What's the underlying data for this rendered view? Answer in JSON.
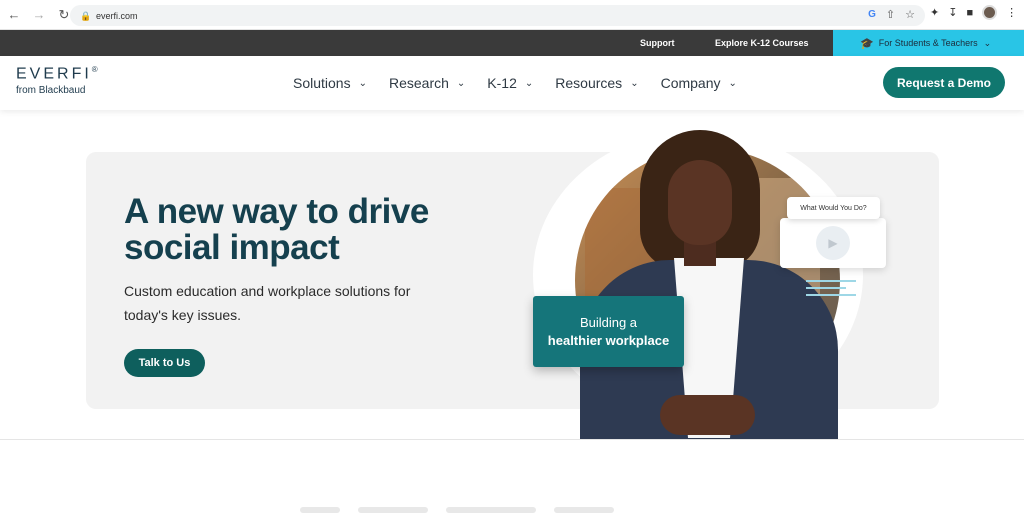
{
  "browser": {
    "url": "everfi.com",
    "icons": [
      "back-icon",
      "forward-icon",
      "reload-icon",
      "lock-icon",
      "google-icon",
      "share-icon",
      "star-icon",
      "extensions-icon",
      "download-icon",
      "sidepanel-icon",
      "profile-avatar",
      "menu-icon"
    ]
  },
  "utility_bar": {
    "support": "Support",
    "explore": "Explore K-12 Courses",
    "students": "For Students & Teachers"
  },
  "nav": {
    "brand": "EVERFI",
    "brand_mark": "®",
    "sub_brand": "from Blackbaud",
    "items": [
      {
        "label": "Solutions"
      },
      {
        "label": "Research"
      },
      {
        "label": "K-12"
      },
      {
        "label": "Resources"
      },
      {
        "label": "Company"
      }
    ],
    "cta": "Request a Demo"
  },
  "hero": {
    "title": "A new way to drive social impact",
    "subtitle": "Custom education and workplace solutions for today's key issues.",
    "cta": "Talk to Us",
    "video_label": "What Would You Do?",
    "card_line1": "Building a",
    "card_line2": "healthier workplace"
  },
  "colors": {
    "utility_bg": "#3a3a3a",
    "students_accent": "#29c5e6",
    "primary_teal": "#10776f",
    "title_color": "#15404e",
    "card_teal": "#15757a"
  }
}
